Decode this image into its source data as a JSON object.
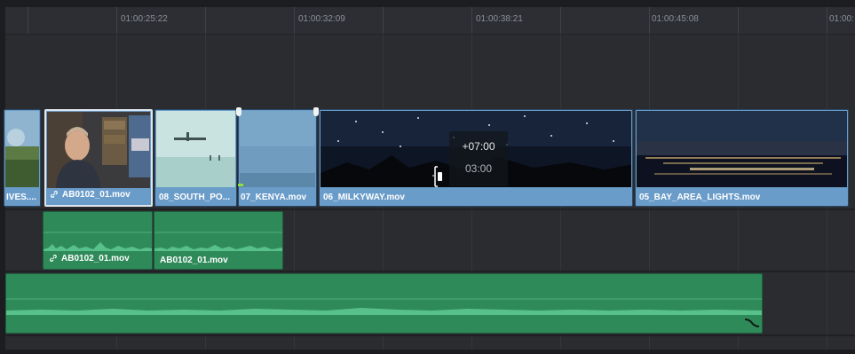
{
  "ruler": {
    "timecodes": [
      "01:00:25:22",
      "01:00:32:09",
      "01:00:38:21",
      "01:00:45:08",
      "01:00:"
    ]
  },
  "video_track": {
    "clips": [
      {
        "name": "IVES....",
        "thumb": "landscape"
      },
      {
        "name": "AB0102_01.mov",
        "thumb": "man-office",
        "linked": true,
        "selected": true
      },
      {
        "name": "08_SOUTH_PO...",
        "thumb": "snow-plane"
      },
      {
        "name": "07_KENYA.mov",
        "thumb": "blue-sky"
      },
      {
        "name": "06_MILKYWAY.mov",
        "thumb": "night-sky"
      },
      {
        "name": "05_BAY_AREA_LIGHTS.mov",
        "thumb": "city-lights"
      }
    ]
  },
  "trim_overlay": {
    "offset": "+07:00",
    "duration": "03:00"
  },
  "audio_track_1": {
    "clips": [
      {
        "name": "AB0102_01.mov",
        "linked": true
      },
      {
        "name": "AB0102_01.mov",
        "linked": false
      }
    ]
  },
  "audio_track_2": {
    "clips": [
      {
        "name": ""
      }
    ]
  },
  "icons": {
    "link": "link-icon",
    "trim_cursor": "trim-cursor-icon",
    "fade": "fade-curve-icon"
  },
  "colors": {
    "video_clip": "#6a9cc9",
    "audio_clip": "#2f8a5a",
    "background": "#2a2c30"
  }
}
